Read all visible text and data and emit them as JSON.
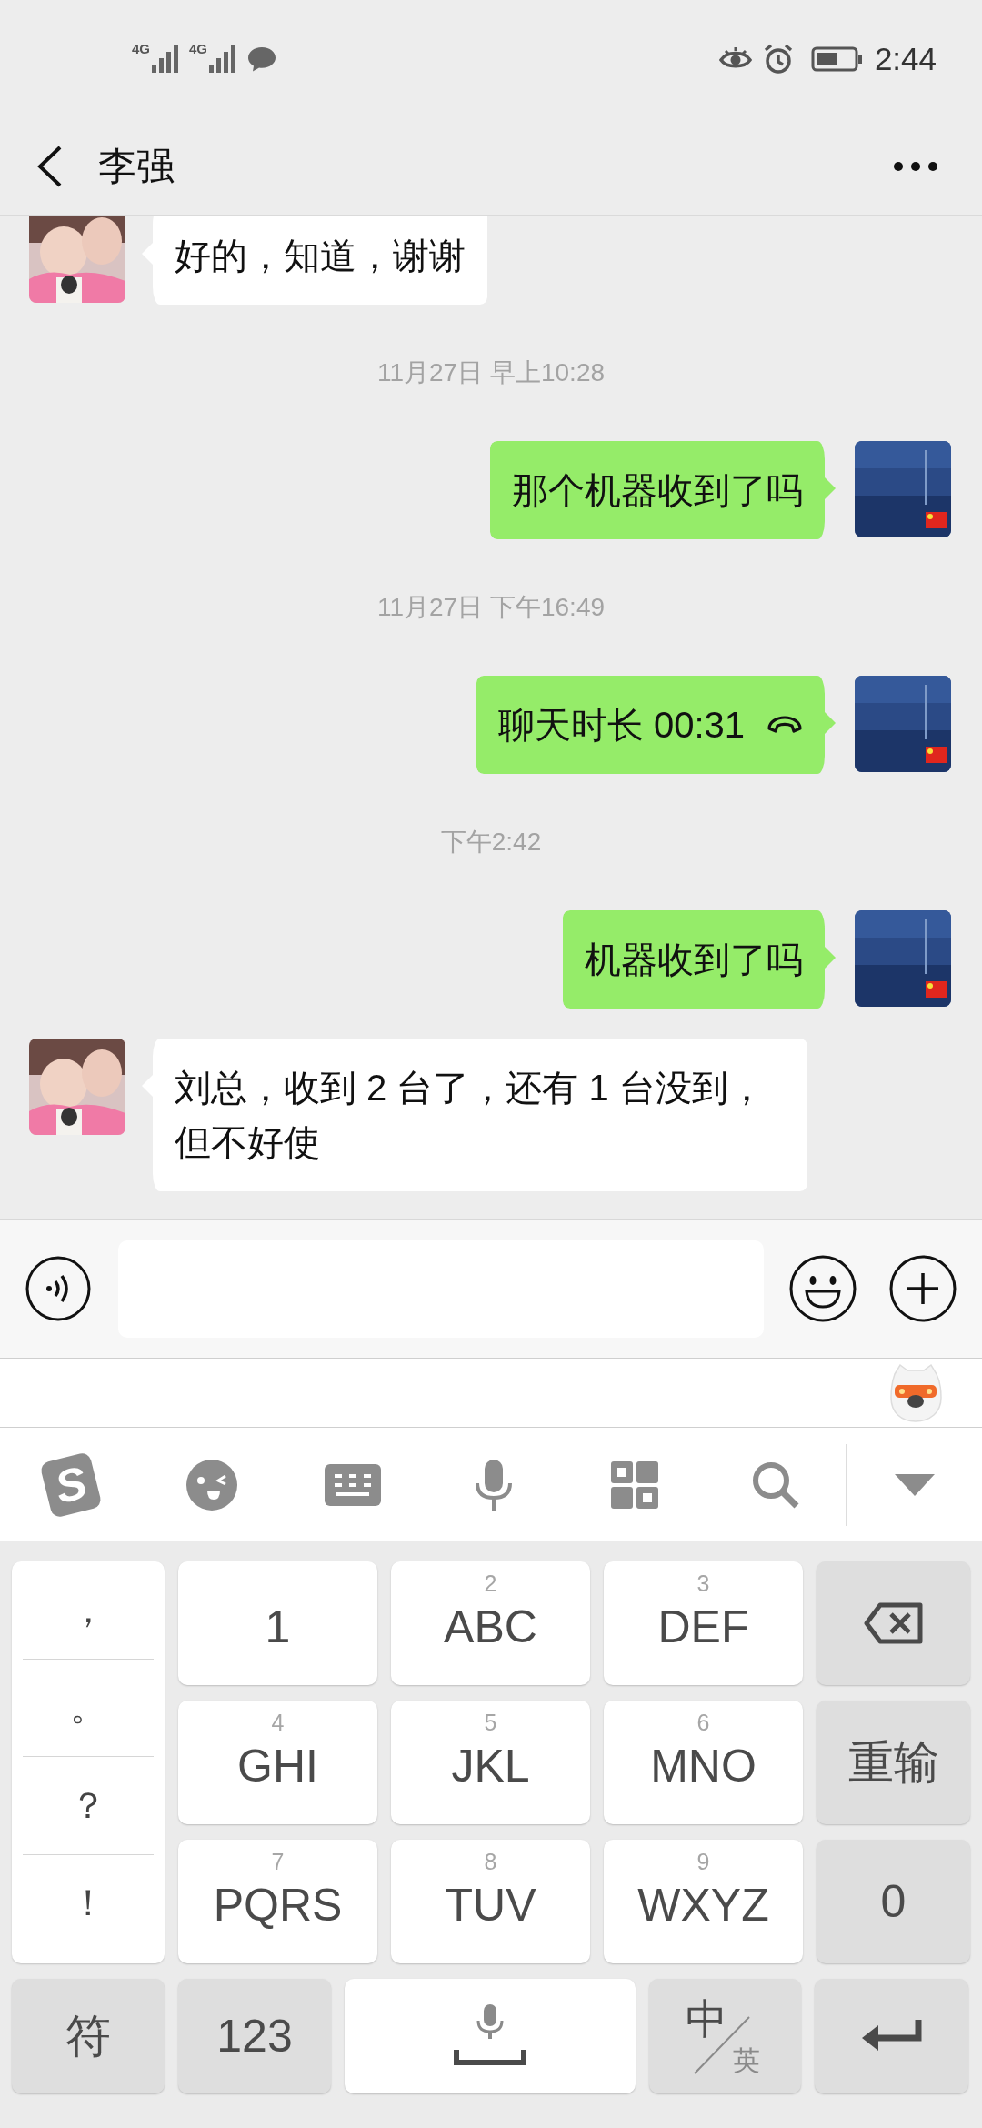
{
  "status_bar": {
    "network_labels": [
      "4G",
      "4G"
    ],
    "time": "2:44"
  },
  "header": {
    "title": "李强"
  },
  "messages": [
    {
      "kind": "received",
      "text": "好的，知道，谢谢"
    },
    {
      "kind": "timestamp",
      "text": "11月27日 早上10:28"
    },
    {
      "kind": "sent",
      "text": "那个机器收到了吗"
    },
    {
      "kind": "timestamp",
      "text": "11月27日 下午16:49"
    },
    {
      "kind": "call",
      "text": "聊天时长 00:31"
    },
    {
      "kind": "timestamp",
      "text": "下午2:42"
    },
    {
      "kind": "sent",
      "text": "机器收到了吗"
    },
    {
      "kind": "received",
      "text": "刘总，收到 2 台了，还有 1 台没到，但不好使"
    }
  ],
  "ime_toolbar": {
    "logo": "S"
  },
  "keyboard": {
    "punctuation": [
      "，",
      "。",
      "？",
      "！"
    ],
    "rows": [
      [
        {
          "kind": "char",
          "label": "1"
        },
        {
          "kind": "char",
          "digit": "2",
          "label": "ABC"
        },
        {
          "kind": "char",
          "digit": "3",
          "label": "DEF"
        },
        {
          "kind": "backspace"
        }
      ],
      [
        {
          "kind": "char",
          "digit": "4",
          "label": "GHI"
        },
        {
          "kind": "char",
          "digit": "5",
          "label": "JKL"
        },
        {
          "kind": "char",
          "digit": "6",
          "label": "MNO"
        },
        {
          "kind": "function",
          "label": "重输"
        }
      ],
      [
        {
          "kind": "char",
          "digit": "7",
          "label": "PQRS"
        },
        {
          "kind": "char",
          "digit": "8",
          "label": "TUV"
        },
        {
          "kind": "char",
          "digit": "9",
          "label": "WXYZ"
        },
        {
          "kind": "function",
          "label": "0"
        }
      ]
    ],
    "bottom_row": [
      {
        "kind": "function",
        "label": "符"
      },
      {
        "kind": "function",
        "label": "123"
      },
      {
        "kind": "space"
      },
      {
        "kind": "language",
        "label": "中",
        "secondary": "英"
      },
      {
        "kind": "enter"
      }
    ]
  }
}
